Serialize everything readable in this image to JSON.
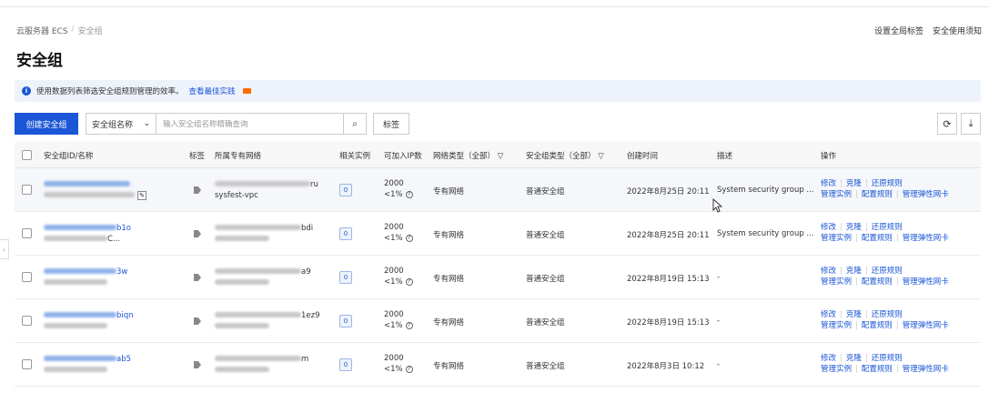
{
  "breadcrumb": {
    "root": "云服务器 ECS",
    "sep": "/",
    "current": "安全组"
  },
  "top_links": {
    "global_tag": "设置全局标签",
    "help": "安全使用须知"
  },
  "page_title": "安全组",
  "notice": {
    "text": "使用数据列表筛选安全组规则管理的效率。",
    "link": "查看最佳实践"
  },
  "toolbar": {
    "create_label": "创建安全组",
    "filter_select": "安全组名称",
    "search_placeholder": "输入安全组名称精确查询",
    "tag_label": "标签",
    "refresh_icon": "refresh-icon",
    "download_icon": "download-icon"
  },
  "columns": {
    "id_name": "安全组ID/名称",
    "tag": "标签",
    "vpc": "所属专有网络",
    "instances": "相关实例",
    "ip_count": "可加入IP数",
    "net_type": "网络类型（全部）",
    "sg_type": "安全组类型（全部）",
    "created": "创建时间",
    "desc": "描述",
    "ops": "操作"
  },
  "rows": [
    {
      "id_tail": "",
      "name_tail": "",
      "vpc_tail": "ru",
      "vpc_name": "sysfest-vpc",
      "count": "0",
      "ip_top": "2000",
      "ip_bottom": "<1%",
      "net": "专有网络",
      "sgtype": "普通安全组",
      "created": "2022年8月25日 20:11",
      "desc": "System security group ...",
      "op1": "修改",
      "op2": "克隆",
      "op3": "还原规则",
      "op4": "管理实例",
      "op5": "配置规则",
      "op6": "管理弹性网卡"
    },
    {
      "id_tail": "b1o",
      "name_tail": "C...",
      "vpc_tail": "bdi",
      "vpc_name": "",
      "count": "0",
      "ip_top": "2000",
      "ip_bottom": "<1%",
      "net": "专有网络",
      "sgtype": "普通安全组",
      "created": "2022年8月25日 20:11",
      "desc": "System security group ...",
      "op1": "修改",
      "op2": "克隆",
      "op3": "还原规则",
      "op4": "管理实例",
      "op5": "配置规则",
      "op6": "管理弹性网卡"
    },
    {
      "id_tail": "3w",
      "name_tail": "",
      "vpc_tail": "a9",
      "vpc_name": "",
      "count": "0",
      "ip_top": "2000",
      "ip_bottom": "<1%",
      "net": "专有网络",
      "sgtype": "普通安全组",
      "created": "2022年8月19日 15:13",
      "desc": "-",
      "op1": "修改",
      "op2": "克隆",
      "op3": "还原规则",
      "op4": "管理实例",
      "op5": "配置规则",
      "op6": "管理弹性网卡"
    },
    {
      "id_tail": "biqn",
      "name_tail": "",
      "vpc_tail": "1ez9",
      "vpc_name": "",
      "count": "0",
      "ip_top": "2000",
      "ip_bottom": "<1%",
      "net": "专有网络",
      "sgtype": "普通安全组",
      "created": "2022年8月19日 15:13",
      "desc": "-",
      "op1": "修改",
      "op2": "克隆",
      "op3": "还原规则",
      "op4": "管理实例",
      "op5": "配置规则",
      "op6": "管理弹性网卡"
    },
    {
      "id_tail": "ab5",
      "name_tail": "",
      "vpc_tail": "m",
      "vpc_name": "",
      "count": "0",
      "ip_top": "2000",
      "ip_bottom": "<1%",
      "net": "专有网络",
      "sgtype": "普通安全组",
      "created": "2022年8月3日 10:12",
      "desc": "-",
      "op1": "修改",
      "op2": "克隆",
      "op3": "还原规则",
      "op4": "管理实例",
      "op5": "配置规则",
      "op6": "管理弹性网卡"
    }
  ]
}
